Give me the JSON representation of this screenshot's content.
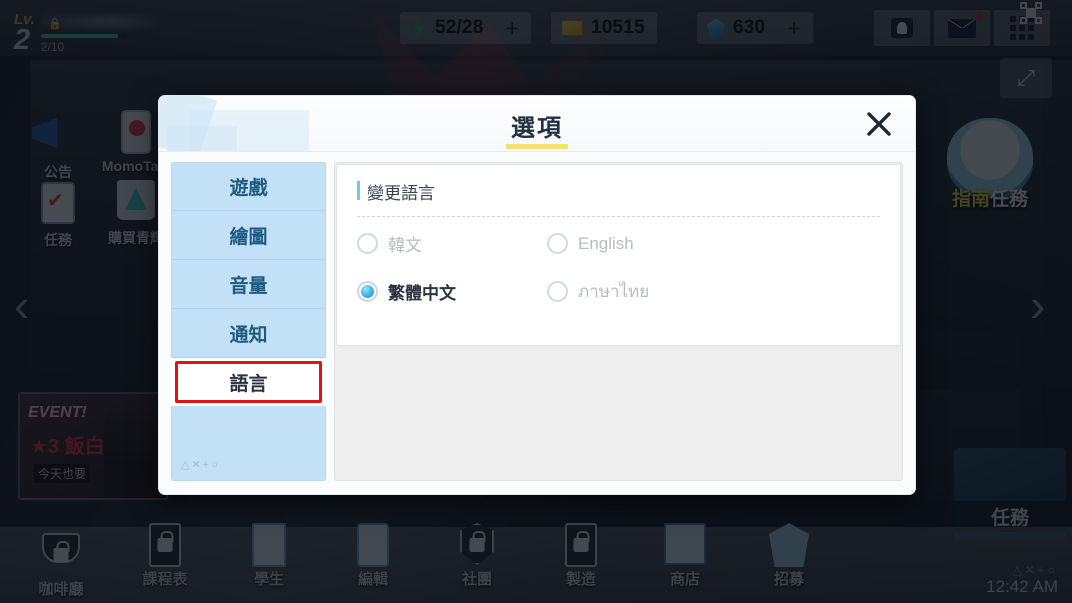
{
  "topbar": {
    "level_prefix": "Lv.",
    "level": "2",
    "xp_text": "2/10",
    "resources": [
      {
        "icon": "ap-icon",
        "value": "52/28",
        "plus": "+"
      },
      {
        "icon": "ticket-icon",
        "value": "10515",
        "plus": ""
      },
      {
        "icon": "gem-icon",
        "value": "630",
        "plus": "+"
      }
    ],
    "icons": [
      "profile-icon",
      "mail-icon",
      "grid-menu-icon",
      "screen-capture-icon",
      "fullscreen-expand-icon"
    ]
  },
  "background": {
    "side_menu": [
      {
        "label": "公告",
        "icon": "megaphone-icon"
      },
      {
        "label": "MomoTalk",
        "icon": "phone-icon"
      },
      {
        "label": "任務",
        "icon": "clipboard-icon"
      },
      {
        "label": "購買青輝",
        "icon": "shopping-bag-icon"
      }
    ],
    "guide_label_part1": "指南",
    "guide_label_part2": "任務",
    "event_banner": {
      "headline": "EVENT!",
      "stars": "★3 飯白",
      "sub": "今天也要"
    },
    "task_panel_label": "任務",
    "left_arrow": "‹",
    "right_arrow": "›"
  },
  "dialog": {
    "title": "選項",
    "close_icon": "close-icon",
    "sidebar": {
      "items": [
        {
          "label": "遊戲",
          "active": false
        },
        {
          "label": "繪圖",
          "active": false
        },
        {
          "label": "音量",
          "active": false
        },
        {
          "label": "通知",
          "active": false
        },
        {
          "label": "語言",
          "active": true
        }
      ],
      "symbols": "△✕+○"
    },
    "content": {
      "section_title": "變更語言",
      "options": [
        {
          "label": "韓文",
          "selected": false
        },
        {
          "label": "English",
          "selected": false
        },
        {
          "label": "繁體中文",
          "selected": true
        },
        {
          "label": "ภาษาไทย",
          "selected": false
        }
      ]
    }
  },
  "bottombar": {
    "items": [
      {
        "label": "咖啡廳",
        "icon": "cafe-icon",
        "locked": true
      },
      {
        "label": "課程表",
        "icon": "schedule-icon",
        "locked": true
      },
      {
        "label": "學生",
        "icon": "students-icon",
        "locked": false
      },
      {
        "label": "編輯",
        "icon": "edit-icon",
        "locked": false
      },
      {
        "label": "社團",
        "icon": "club-icon",
        "locked": true
      },
      {
        "label": "製造",
        "icon": "craft-icon",
        "locked": true
      },
      {
        "label": "商店",
        "icon": "shop-icon",
        "locked": false
      },
      {
        "label": "招募",
        "icon": "recruit-icon",
        "locked": false
      }
    ],
    "symbols": "△✕+○",
    "clock": "12:42 AM"
  },
  "colors": {
    "accent_blue": "#79c6e8",
    "radio_selected": "#35b6ea",
    "title_underline": "#f5e06b",
    "highlight_red": "#e11414",
    "sidebar_bg": "#c3e1f6"
  }
}
